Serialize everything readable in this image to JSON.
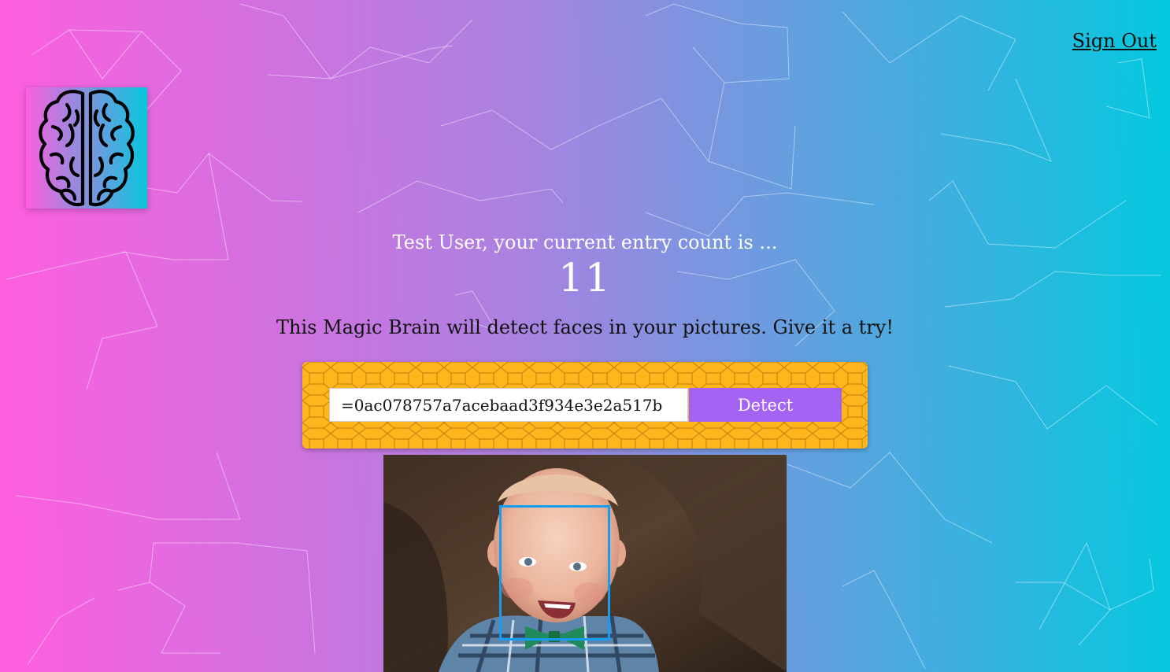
{
  "nav": {
    "sign_out_label": "Sign Out"
  },
  "logo": {
    "icon": "brain-icon"
  },
  "rank": {
    "greeting": "Test User, your current entry count is ...",
    "count": "11"
  },
  "tagline": "This Magic Brain will detect faces in your pictures. Give it a try!",
  "form": {
    "image_url_value": "=0ac078757a7acebaad3f934e3e2a517b",
    "detect_label": "Detect"
  },
  "colors": {
    "gradient_start": "#ff5edf",
    "gradient_end": "#04c8de",
    "detect_button": "#a463f2",
    "form_background": "#ffb51c",
    "face_box": "#149df2"
  }
}
